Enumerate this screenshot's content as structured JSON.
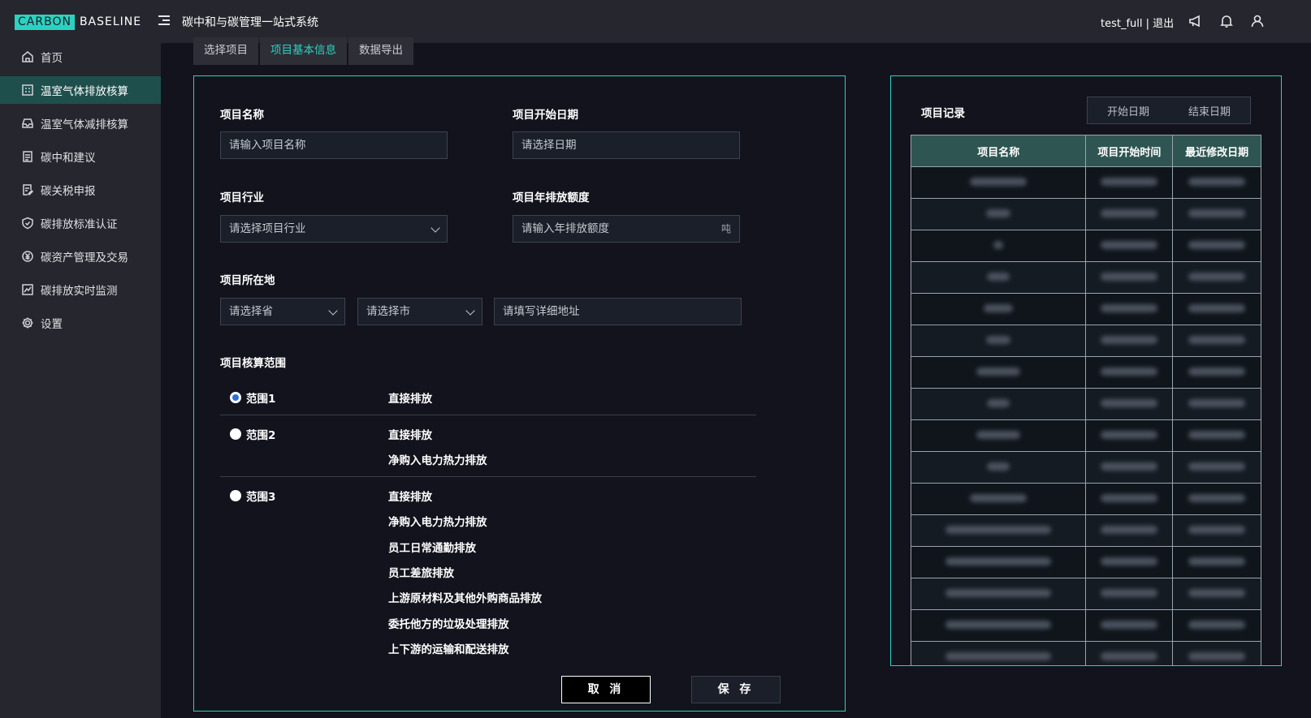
{
  "header": {
    "logo_box": "CARBON",
    "logo_text": "BASELINE",
    "system_title": "碳中和与碳管理一站式系统",
    "user": "test_full | 退出",
    "icons": [
      "megaphone-icon",
      "bell-icon",
      "user-icon"
    ]
  },
  "sidebar": {
    "items": [
      {
        "label": "首页",
        "icon": "home-icon",
        "active": false
      },
      {
        "label": "温室气体排放核算",
        "icon": "calculator-icon",
        "active": true
      },
      {
        "label": "温室气体减排核算",
        "icon": "inbox-icon",
        "active": false
      },
      {
        "label": "碳中和建议",
        "icon": "document-icon",
        "active": false
      },
      {
        "label": "碳关税申报",
        "icon": "file-edit-icon",
        "active": false
      },
      {
        "label": "碳排放标准认证",
        "icon": "shield-check-icon",
        "active": false
      },
      {
        "label": "碳资产管理及交易",
        "icon": "yuan-circle-icon",
        "active": false
      },
      {
        "label": "碳排放实时监测",
        "icon": "line-chart-icon",
        "active": false
      },
      {
        "label": "设置",
        "icon": "gear-icon",
        "active": false
      }
    ]
  },
  "tabs": [
    {
      "label": "选择项目",
      "active": false
    },
    {
      "label": "项目基本信息",
      "active": true
    },
    {
      "label": "数据导出",
      "active": false
    }
  ],
  "form": {
    "name_label": "项目名称",
    "name_placeholder": "请输入项目名称",
    "start_label": "项目开始日期",
    "start_placeholder": "请选择日期",
    "industry_label": "项目行业",
    "industry_placeholder": "请选择项目行业",
    "quota_label": "项目年排放额度",
    "quota_placeholder": "请输入年排放额度",
    "quota_unit": "吨",
    "location_label": "项目所在地",
    "province_placeholder": "请选择省",
    "city_placeholder": "请选择市",
    "address_placeholder": "请填写详细地址",
    "scope_label": "项目核算范围",
    "scopes": [
      {
        "name": "范围1",
        "checked": true,
        "items": [
          "直接排放"
        ]
      },
      {
        "name": "范围2",
        "checked": false,
        "items": [
          "直接排放",
          "净购入电力热力排放"
        ]
      },
      {
        "name": "范围3",
        "checked": false,
        "items": [
          "直接排放",
          "净购入电力热力排放",
          "员工日常通勤排放",
          "员工差旅排放",
          "上游原材料及其他外购商品排放",
          "委托他方的垃圾处理排放",
          "上下游的运输和配送排放"
        ]
      }
    ],
    "cancel_label": "取 消",
    "save_label": "保 存"
  },
  "records": {
    "title": "项目记录",
    "start_date": "开始日期",
    "end_date": "结束日期",
    "columns": [
      "项目名称",
      "项目开始时间",
      "最近修改日期"
    ],
    "row_count": 16
  },
  "colors": {
    "accent": "#2ad2c0",
    "sidebar_active": "#1f4f4d",
    "table_header": "#2e5552"
  }
}
